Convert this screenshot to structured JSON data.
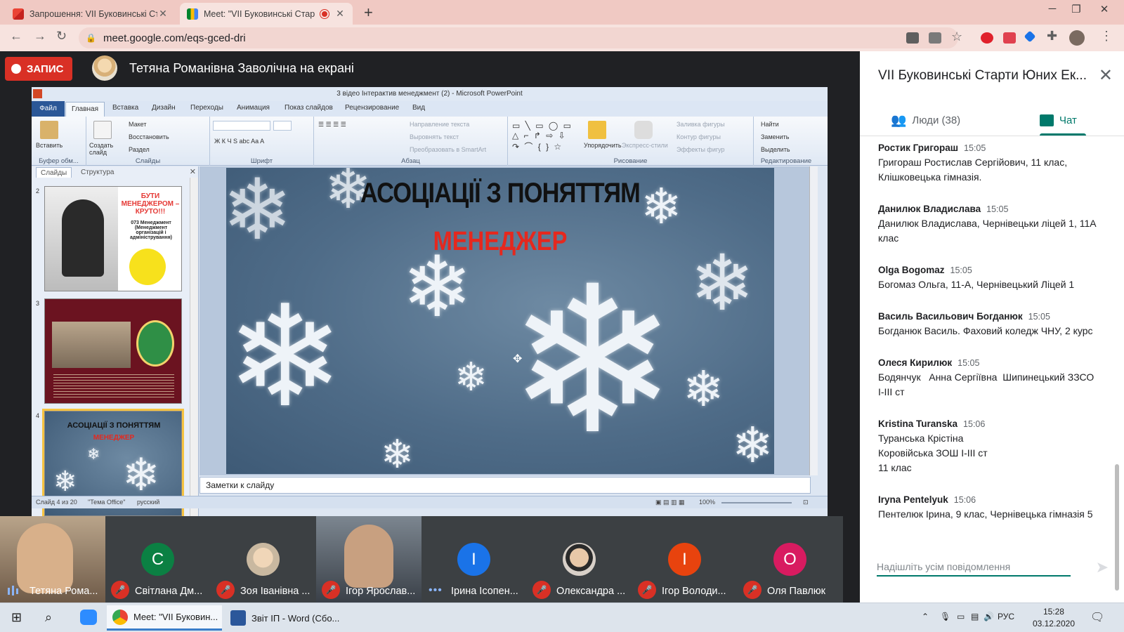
{
  "browser": {
    "tabs": [
      {
        "label": "Запрошення: VII Буковинські Ст",
        "icon": "gmail-icon"
      },
      {
        "label": "Meet: \"VII Буковинські Стар",
        "icon": "meet-icon"
      }
    ],
    "url": "meet.google.com/eqs-gced-dri",
    "window_controls": [
      "─",
      "❐",
      "✕"
    ]
  },
  "meet": {
    "record_label": "ЗАПИС",
    "presenter_label": "Тетяна Романівна Заволічна на екрані"
  },
  "ppt": {
    "window_title": "3 відео Інтерактив менеджмент (2) - Microsoft PowerPoint",
    "tabs": [
      "Файл",
      "Главная",
      "Вставка",
      "Дизайн",
      "Переходы",
      "Анимация",
      "Показ слайдов",
      "Рецензирование",
      "Вид"
    ],
    "groups": {
      "clipboard": "Буфер обм...",
      "slides": "Слайды",
      "font": "Шрифт",
      "paragraph": "Абзац",
      "drawing": "Рисование",
      "editing": "Редактирование"
    },
    "buttons": {
      "paste": "Вставить",
      "new_slide": "Создать слайд",
      "layout": "Макет",
      "reset": "Восстановить",
      "section": "Раздел",
      "text_dir": "Направление текста",
      "align_text": "Выровнять текст",
      "smartart": "Преобразовать в SmartArt",
      "arrange": "Упорядочить",
      "quick_styles": "Экспресс-стили",
      "shape_fill": "Заливка фигуры",
      "shape_outline": "Контур фигуры",
      "shape_effects": "Эффекты фигур",
      "find": "Найти",
      "replace": "Заменить",
      "select": "Выделить"
    },
    "pane_tabs": [
      "Слайды",
      "Структура"
    ],
    "thumbs": [
      {
        "num": "2",
        "text": "БУТИ МЕНЕДЖЕРОМ – КРУТО!!!",
        "sub": "073 Менеджмент (Менеджмент організацій і адміністрування)"
      },
      {
        "num": "3"
      },
      {
        "num": "4",
        "text": "АСОЦІАЦІЇ З ПОНЯТТЯМ",
        "sub": "МЕНЕДЖЕР"
      }
    ],
    "slide": {
      "title_line1": "АСОЦІАЦІЇ З ПОНЯТТЯМ",
      "title_line2": "МЕНЕДЖЕР"
    },
    "notes_placeholder": "Заметки к слайду",
    "status": {
      "slide_info": "Слайд 4 из 20",
      "theme": "\"Тема Office\"",
      "language": "русский",
      "zoom": "100%"
    }
  },
  "participants": [
    {
      "name": "Тетяна Рома...",
      "initial": "",
      "color": "#8a6a50",
      "state": "speaking",
      "type": "video"
    },
    {
      "name": "Світлана Дм...",
      "initial": "С",
      "color": "#0b8043",
      "state": "muted",
      "type": "letter"
    },
    {
      "name": "Зоя Іванівна ...",
      "initial": "",
      "color": "#c9b8a0",
      "state": "muted",
      "type": "photo"
    },
    {
      "name": "Ігор Ярослав...",
      "initial": "",
      "color": "#5a6470",
      "state": "muted",
      "type": "video"
    },
    {
      "name": "Ірина Ісопен...",
      "initial": "І",
      "color": "#1a73e8",
      "state": "more",
      "type": "letter"
    },
    {
      "name": "Олександра ...",
      "initial": "",
      "color": "#b9a89a",
      "state": "muted",
      "type": "photo"
    },
    {
      "name": "Ігор Володи...",
      "initial": "І",
      "color": "#e8430e",
      "state": "muted",
      "type": "letter"
    },
    {
      "name": "Оля Павлюк",
      "initial": "О",
      "color": "#d81b60",
      "state": "muted",
      "type": "letter"
    }
  ],
  "panel": {
    "title": "VII Буковинські Старти Юних Ек...",
    "people_tab": "Люди (38)",
    "chat_tab": "Чат",
    "messages": [
      {
        "sender": "Ростик Григораш",
        "time": "15:05",
        "lines": [
          "Григораш Ростислав Сергійович, 11 клас,",
          "Клішковецька гімназія."
        ]
      },
      {
        "sender": "Данилюк Владислава",
        "time": "15:05",
        "lines": [
          "Данилюк Владислава, Чернівецьки ліцей 1, 11А",
          "клас"
        ]
      },
      {
        "sender": "Olga Bogomaz",
        "time": "15:05",
        "lines": [
          "Богомаз Ольга, 11-А, Чернівецький Ліцей 1"
        ]
      },
      {
        "sender": "Василь Васильович Богданюк",
        "time": "15:05",
        "lines": [
          "Богданюк Василь. Фаховий коледж ЧНУ, 2 курс"
        ]
      },
      {
        "sender": "Олеся Кирилюк",
        "time": "15:05",
        "lines": [
          "Бодянчук   Анна Сергіївна  Шипинецький ЗЗСО",
          "І-ІІІ ст"
        ]
      },
      {
        "sender": "Kristina Turanska",
        "time": "15:06",
        "lines": [
          "Туранська Крістіна",
          "Коровійська ЗОШ І-ІІІ ст",
          "11 клас"
        ]
      },
      {
        "sender": "Iryna Pentelyuk",
        "time": "15:06",
        "lines": [
          "Пентелюк Ірина, 9 клас, Чернівецька гімназія 5"
        ]
      }
    ],
    "input_placeholder": "Надішліть усім повідомлення"
  },
  "taskbar": {
    "apps": [
      {
        "label": "Meet: \"VII Буковин...",
        "icon": "chrome-icon",
        "active": true
      },
      {
        "label": "Звіт ІП - Word (Сбо...",
        "icon": "word-icon",
        "active": false
      }
    ],
    "lang": "РУС",
    "time": "15:28",
    "date": "03.12.2020"
  },
  "colors": {
    "record_red": "#d93025",
    "chat_accent": "#00796b",
    "meet_bg": "#202124",
    "tab_strip": "#f0c9c3"
  }
}
